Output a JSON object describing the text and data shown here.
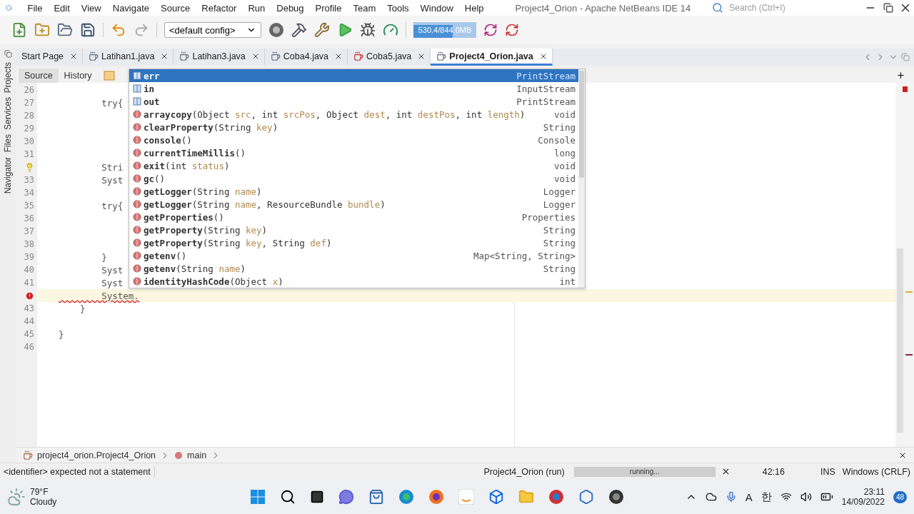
{
  "window": {
    "title": "Project4_Orion - Apache NetBeans IDE 14",
    "search_placeholder": "Search (Ctrl+I)"
  },
  "menus": [
    "File",
    "Edit",
    "View",
    "Navigate",
    "Source",
    "Refactor",
    "Run",
    "Debug",
    "Profile",
    "Team",
    "Tools",
    "Window",
    "Help"
  ],
  "toolbar": {
    "config": "<default config>",
    "memory": {
      "text": "530.4/844.0MB",
      "level": 0.63
    }
  },
  "tabs": [
    {
      "label": "Start Page",
      "selected": false,
      "error": false,
      "file": false
    },
    {
      "label": "Latihan1.java",
      "selected": false,
      "error": false,
      "file": true
    },
    {
      "label": "Latihan3.java",
      "selected": false,
      "error": false,
      "file": true
    },
    {
      "label": "Coba4.java",
      "selected": false,
      "error": false,
      "file": true
    },
    {
      "label": "Coba5.java",
      "selected": false,
      "error": true,
      "file": true
    },
    {
      "label": "Project4_Orion.java",
      "selected": true,
      "error": false,
      "file": true
    }
  ],
  "editor_views": [
    {
      "label": "Source",
      "selected": true
    },
    {
      "label": "History",
      "selected": false
    }
  ],
  "side_panels": [
    {
      "label": "Projects"
    },
    {
      "label": "Services"
    },
    {
      "label": "Files"
    },
    {
      "label": "Navigator"
    }
  ],
  "code": {
    "lines": [
      {
        "kind": "numbered",
        "number": "26",
        "current": false
      },
      {
        "kind": "numbered",
        "number": "27",
        "text": "        try{",
        "current": false
      },
      {
        "kind": "numbered",
        "number": "28",
        "current": false
      },
      {
        "kind": "numbered",
        "number": "29",
        "current": false
      },
      {
        "kind": "numbered",
        "number": "30",
        "current": false
      },
      {
        "kind": "numbered",
        "number": "31",
        "current": false
      },
      {
        "kind": "warning",
        "text": "        Stri",
        "current": false
      },
      {
        "kind": "numbered",
        "number": "33",
        "text": "        Syst",
        "current": false
      },
      {
        "kind": "numbered",
        "number": "34",
        "current": false
      },
      {
        "kind": "numbered",
        "number": "35",
        "text": "        try{",
        "current": false
      },
      {
        "kind": "numbered",
        "number": "36",
        "current": false
      },
      {
        "kind": "numbered",
        "number": "37",
        "current": false
      },
      {
        "kind": "numbered",
        "number": "38",
        "current": false
      },
      {
        "kind": "numbered",
        "number": "39",
        "text": "        }",
        "current": false
      },
      {
        "kind": "numbered",
        "number": "40",
        "text": "        Syst",
        "current": false
      },
      {
        "kind": "numbered",
        "number": "41",
        "text": "        Syst",
        "current": false
      },
      {
        "kind": "error",
        "text": "        System.",
        "current": true
      },
      {
        "kind": "numbered",
        "number": "43",
        "text": "    }",
        "current": false
      },
      {
        "kind": "numbered",
        "number": "44",
        "current": false
      },
      {
        "kind": "numbered",
        "number": "45",
        "text": "}",
        "current": false
      },
      {
        "kind": "numbered",
        "number": "46",
        "current": false
      }
    ]
  },
  "completion": {
    "items": [
      {
        "kind": "field",
        "name": "err",
        "type": "PrintStream",
        "selected": true
      },
      {
        "kind": "field",
        "name": "in",
        "type": "InputStream",
        "selected": false
      },
      {
        "kind": "field",
        "name": "out",
        "type": "PrintStream",
        "selected": false
      },
      {
        "kind": "method",
        "name": "arraycopy",
        "params": "(Object src, int srcPos, Object dest, int destPos, int length)",
        "type": "void",
        "selected": false
      },
      {
        "kind": "method",
        "name": "clearProperty",
        "params": "(String key)",
        "type": "String",
        "selected": false
      },
      {
        "kind": "method",
        "name": "console",
        "params": "()",
        "type": "Console",
        "selected": false
      },
      {
        "kind": "method",
        "name": "currentTimeMillis",
        "params": "()",
        "type": "long",
        "selected": false
      },
      {
        "kind": "method",
        "name": "exit",
        "params": "(int status)",
        "type": "void",
        "selected": false
      },
      {
        "kind": "method",
        "name": "gc",
        "params": "()",
        "type": "void",
        "selected": false
      },
      {
        "kind": "method",
        "name": "getLogger",
        "params": "(String name)",
        "type": "Logger",
        "selected": false
      },
      {
        "kind": "method",
        "name": "getLogger",
        "params": "(String name, ResourceBundle bundle)",
        "type": "Logger",
        "selected": false
      },
      {
        "kind": "method",
        "name": "getProperties",
        "params": "()",
        "type": "Properties",
        "selected": false
      },
      {
        "kind": "method",
        "name": "getProperty",
        "params": "(String key)",
        "type": "String",
        "selected": false
      },
      {
        "kind": "method",
        "name": "getProperty",
        "params": "(String key, String def)",
        "type": "String",
        "selected": false
      },
      {
        "kind": "method",
        "name": "getenv",
        "params": "()",
        "type": "Map<String, String>",
        "selected": false
      },
      {
        "kind": "method",
        "name": "getenv",
        "params": "(String name)",
        "type": "String",
        "selected": false
      },
      {
        "kind": "method",
        "name": "identityHashCode",
        "params": "(Object x)",
        "type": "int",
        "selected": false
      }
    ]
  },
  "breadcrumb": [
    {
      "label": "project4_orion.Project4_Orion",
      "kind": "class"
    },
    {
      "label": "main",
      "kind": "method"
    }
  ],
  "status_bar": {
    "message": "<identifier> expected  not a statement",
    "task": "Project4_Orion (run)",
    "progress": {
      "text": "running...",
      "level": 1
    },
    "position": "42:16",
    "mode": "INS",
    "line_ending": "Windows (CRLF)"
  },
  "taskbar": {
    "temperature": "79°F",
    "weather": "Cloudy",
    "tray_texts": [
      "A",
      "한"
    ],
    "time": "23:11",
    "date": "14/09/2022",
    "badge": "48"
  }
}
